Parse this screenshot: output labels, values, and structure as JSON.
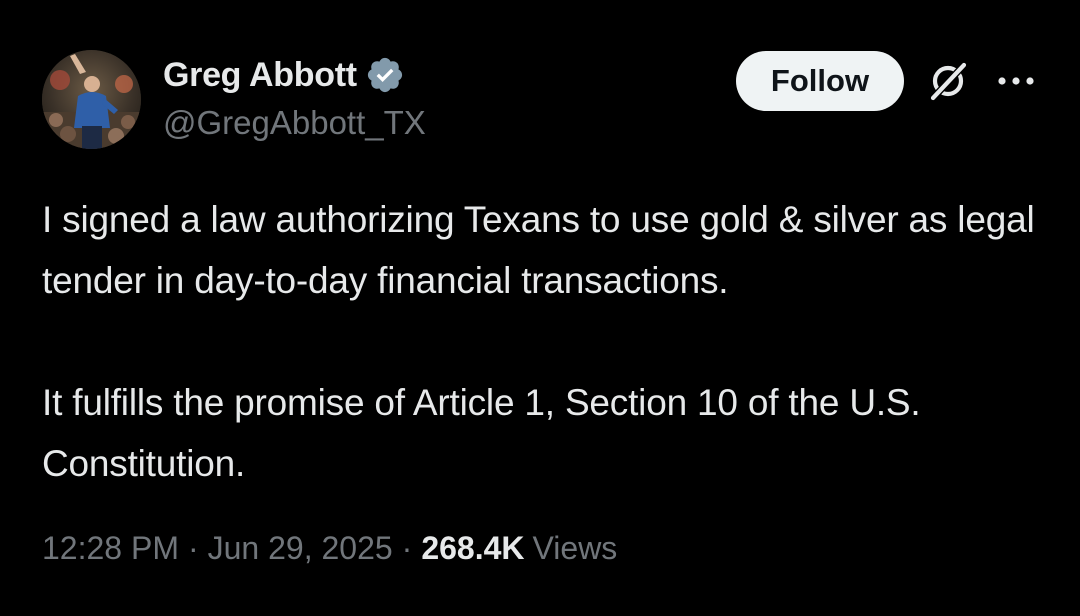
{
  "author": {
    "display_name": "Greg Abbott",
    "handle": "@GregAbbott_TX",
    "verified": true,
    "verified_color": "#829aab",
    "avatar_icon": "profile-photo"
  },
  "actions": {
    "follow_label": "Follow",
    "grok_icon": "grok-icon",
    "more_icon": "more-options-icon"
  },
  "tweet": {
    "paragraphs": [
      "I signed a law authorizing Texans to use gold & silver as legal tender in day-to-day financial transactions.",
      "It fulfills the promise of Article 1, Section 10 of the U.S. Constitution."
    ]
  },
  "meta": {
    "time": "12:28 PM",
    "date": "Jun 29, 2025",
    "separator": "·",
    "views_count": "268.4K",
    "views_label": "Views"
  },
  "colors": {
    "background": "#000000",
    "primary_text": "#e7e9ea",
    "secondary_text": "#71767b",
    "follow_bg": "#eff3f4",
    "follow_text": "#0f1419"
  }
}
